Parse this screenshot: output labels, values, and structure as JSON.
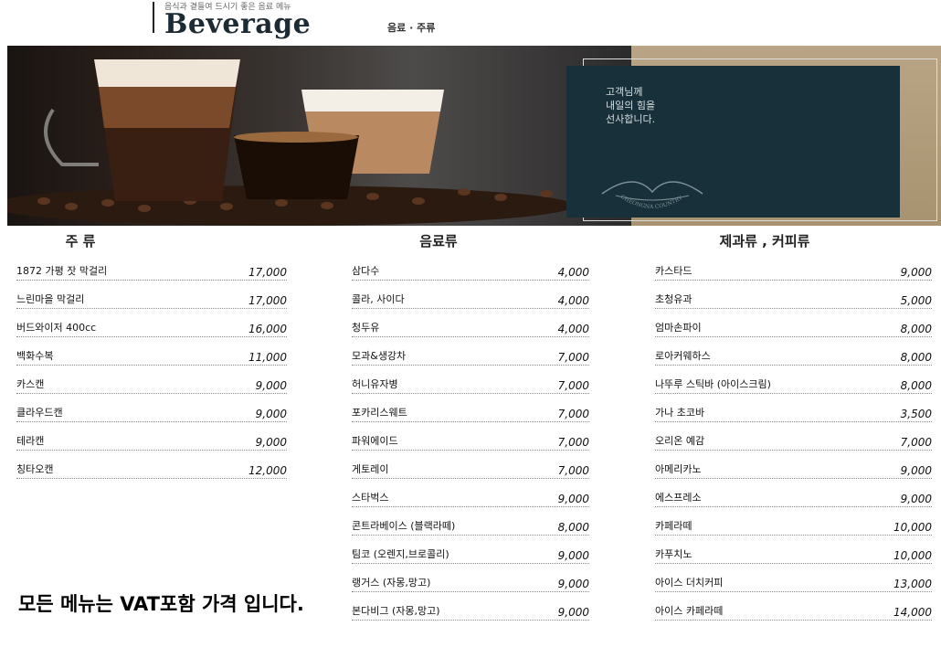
{
  "header": {
    "subtitle": "음식과 곁들여 드시기 좋은 음료 메뉴",
    "title": "Beverage",
    "title_sub": "음료 · 주류"
  },
  "hero": {
    "message_lines": [
      "고객님께",
      "내일의 힘을",
      "선사합니다."
    ],
    "logo_text": "CHEONGNA COUNTRY CLUB"
  },
  "columns": [
    {
      "title": "주 류",
      "items": [
        {
          "name": "1872 가평 잣 막걸리",
          "price": "17,000"
        },
        {
          "name": "느린마을 막걸리",
          "price": "17,000"
        },
        {
          "name": "버드와이저 400cc",
          "price": "16,000"
        },
        {
          "name": "백화수복",
          "price": "11,000"
        },
        {
          "name": "카스캔",
          "price": "9,000"
        },
        {
          "name": "클라우드캔",
          "price": "9,000"
        },
        {
          "name": "테라캔",
          "price": "9,000"
        },
        {
          "name": "칭타오캔",
          "price": "12,000"
        }
      ]
    },
    {
      "title": "음료류",
      "items": [
        {
          "name": "삼다수",
          "price": "4,000"
        },
        {
          "name": "콜라, 사이다",
          "price": "4,000"
        },
        {
          "name": "청두유",
          "price": "4,000"
        },
        {
          "name": "모과&생강차",
          "price": "7,000"
        },
        {
          "name": "허니유자병",
          "price": "7,000"
        },
        {
          "name": "포카리스웨트",
          "price": "7,000"
        },
        {
          "name": "파워에이드",
          "price": "7,000"
        },
        {
          "name": "게토레이",
          "price": "7,000"
        },
        {
          "name": "스타벅스",
          "price": "9,000"
        },
        {
          "name": "콘트라베이스 (블랙라떼)",
          "price": "8,000"
        },
        {
          "name": "팀코 (오렌지,브로콜리)",
          "price": "9,000"
        },
        {
          "name": "랭거스 (자몽,망고)",
          "price": "9,000"
        },
        {
          "name": "본다비그 (자몽,망고)",
          "price": "9,000"
        }
      ]
    },
    {
      "title": "제과류 , 커피류",
      "items": [
        {
          "name": "카스타드",
          "price": "9,000"
        },
        {
          "name": "초청유과",
          "price": "5,000"
        },
        {
          "name": "엄마손파이",
          "price": "8,000"
        },
        {
          "name": "로아커웨하스",
          "price": "8,000"
        },
        {
          "name": "나뚜루 스틱바 (아이스크림)",
          "price": "8,000"
        },
        {
          "name": "가나 초코바",
          "price": "3,500"
        },
        {
          "name": "오리온 예감",
          "price": "7,000"
        },
        {
          "name": "아메리카노",
          "price": "9,000"
        },
        {
          "name": "에스프레소",
          "price": "9,000"
        },
        {
          "name": "카페라떼",
          "price": "10,000"
        },
        {
          "name": "카푸치노",
          "price": "10,000"
        },
        {
          "name": "아이스 더치커피",
          "price": "13,000"
        },
        {
          "name": "아이스 카페라떼",
          "price": "14,000"
        }
      ]
    }
  ],
  "footer": {
    "vat_note": "모든 메뉴는 VAT포함 가격 입니다."
  }
}
